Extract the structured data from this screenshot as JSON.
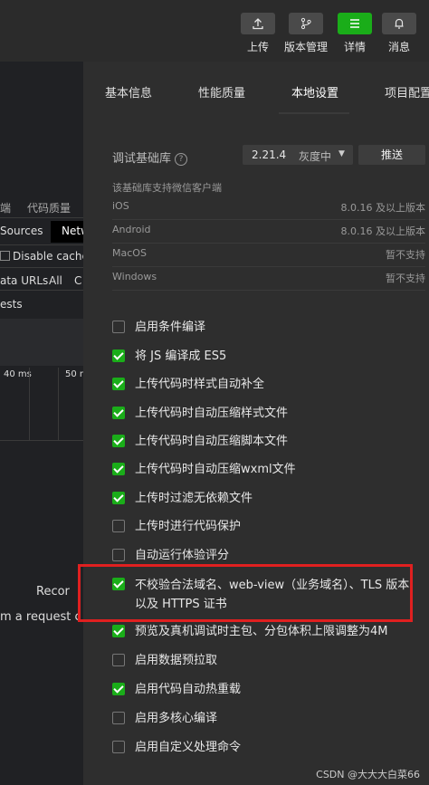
{
  "toolbar": {
    "items": [
      {
        "label": "上传",
        "icon": "upload-icon"
      },
      {
        "label": "版本管理",
        "icon": "branch-icon"
      },
      {
        "label": "详情",
        "icon": "menu-icon",
        "active": true
      },
      {
        "label": "消息",
        "icon": "bell-icon"
      }
    ]
  },
  "devtools": {
    "tab_frag1": "端",
    "tab_frag2": "代码质量",
    "sources": "Sources",
    "netw": "Netw",
    "disable_cache": "Disable cache",
    "data_urls": "ata URLs",
    "all": "All",
    "c": "C",
    "requests": "ests",
    "tick1": "40 ms",
    "tick2": "50 m",
    "recording": "Recor",
    "request_hint": "m a request c"
  },
  "panel": {
    "tabs": [
      "基本信息",
      "性能质量",
      "本地设置",
      "项目配置"
    ],
    "active_tab": "本地设置",
    "lib": {
      "label": "调试基础库",
      "help_icon": "?",
      "version": "2.21.4",
      "gray": "灰度中",
      "push": "推送"
    },
    "support_header": "该基础库支持微信客户端",
    "support": [
      {
        "name": "iOS",
        "status": "8.0.16 及以上版本"
      },
      {
        "name": "Android",
        "status": "8.0.16 及以上版本"
      },
      {
        "name": "MacOS",
        "status": "暂不支持"
      },
      {
        "name": "Windows",
        "status": "暂不支持"
      }
    ],
    "options": [
      {
        "label": "启用条件编译",
        "checked": false
      },
      {
        "label": "将 JS 编译成 ES5",
        "checked": true
      },
      {
        "label": "上传代码时样式自动补全",
        "checked": true
      },
      {
        "label": "上传代码时自动压缩样式文件",
        "checked": true
      },
      {
        "label": "上传代码时自动压缩脚本文件",
        "checked": true
      },
      {
        "label": "上传代码时自动压缩wxml文件",
        "checked": true
      },
      {
        "label": "上传时过滤无依赖文件",
        "checked": true
      },
      {
        "label": "上传时进行代码保护",
        "checked": false
      },
      {
        "label": "自动运行体验评分",
        "checked": false
      },
      {
        "label": "不校验合法域名、web-view（业务域名）、TLS 版本以及 HTTPS 证书",
        "checked": true
      },
      {
        "label": "预览及真机调试时主包、分包体积上限调整为4M",
        "checked": true
      },
      {
        "label": "启用数据预拉取",
        "checked": false
      },
      {
        "label": "启用代码自动热重载",
        "checked": true
      },
      {
        "label": "启用多核心编译",
        "checked": false
      },
      {
        "label": "启用自定义处理命令",
        "checked": false
      }
    ]
  },
  "watermark": "CSDN @大大大白菜66",
  "colors": {
    "accent": "#1aad19",
    "highlight": "#e02020",
    "panel_bg": "#2e2e2e"
  }
}
